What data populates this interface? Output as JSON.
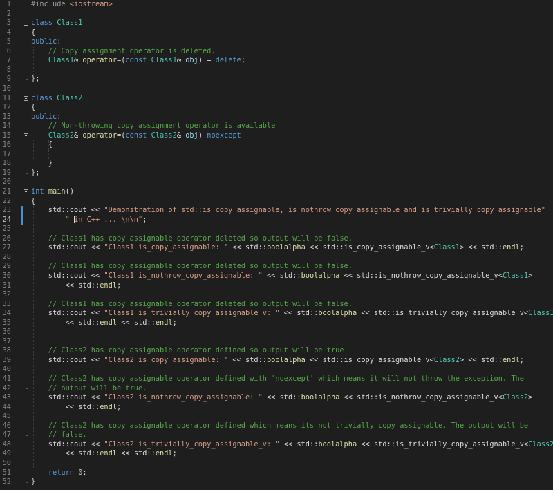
{
  "editor": {
    "current_line": 24,
    "lines": [
      [
        [
          "pp",
          "#include "
        ],
        [
          "st",
          "<iostream>"
        ]
      ],
      [],
      [
        [
          "kw",
          "class "
        ],
        [
          "ty",
          "Class1"
        ]
      ],
      [
        [
          "pl",
          "{"
        ]
      ],
      [
        [
          "kw",
          "public"
        ],
        [
          "pl",
          ":"
        ]
      ],
      [
        [
          "pl",
          "    "
        ],
        [
          "cm",
          "// Copy assignment operator is deleted."
        ]
      ],
      [
        [
          "pl",
          "    "
        ],
        [
          "ty",
          "Class1"
        ],
        [
          "pl",
          "& "
        ],
        [
          "fn",
          "operator="
        ],
        [
          "pl",
          "("
        ],
        [
          "kw",
          "const "
        ],
        [
          "ty",
          "Class1"
        ],
        [
          "pl",
          "& "
        ],
        [
          "pr",
          "obj"
        ],
        [
          "pl",
          ") = "
        ],
        [
          "kw",
          "delete"
        ],
        [
          "pl",
          ";"
        ]
      ],
      [],
      [
        [
          "pl",
          "};"
        ]
      ],
      [],
      [
        [
          "kw",
          "class "
        ],
        [
          "ty",
          "Class2"
        ]
      ],
      [
        [
          "pl",
          "{"
        ]
      ],
      [
        [
          "kw",
          "public"
        ],
        [
          "pl",
          ":"
        ]
      ],
      [
        [
          "pl",
          "    "
        ],
        [
          "cm",
          "// Non-throwing copy assignment operator is available"
        ]
      ],
      [
        [
          "pl",
          "    "
        ],
        [
          "ty",
          "Class2"
        ],
        [
          "pl",
          "& "
        ],
        [
          "fn",
          "operator="
        ],
        [
          "pl",
          "("
        ],
        [
          "kw",
          "const "
        ],
        [
          "ty",
          "Class2"
        ],
        [
          "pl",
          "& "
        ],
        [
          "pr",
          "obj"
        ],
        [
          "pl",
          ") "
        ],
        [
          "kw",
          "noexcept"
        ]
      ],
      [
        [
          "pl",
          "    {"
        ]
      ],
      [],
      [
        [
          "pl",
          "    }"
        ]
      ],
      [
        [
          "pl",
          "};"
        ]
      ],
      [],
      [
        [
          "kw",
          "int "
        ],
        [
          "fn",
          "main"
        ],
        [
          "pl",
          "()"
        ]
      ],
      [
        [
          "pl",
          "{"
        ]
      ],
      [
        [
          "pl",
          "    std::cout << "
        ],
        [
          "st",
          "\"Demonstration of std::is_copy_assignable, is_nothrow_copy_assignable and is_trivially_copy_assignable\""
        ]
      ],
      [
        [
          "pl",
          "        "
        ],
        [
          "st",
          "\" in C++ ... \\n\\n\""
        ],
        [
          "pl",
          ";"
        ]
      ],
      [],
      [
        [
          "pl",
          "    "
        ],
        [
          "cm",
          "// Class1 has copy assignable operator deleted so output will be false."
        ]
      ],
      [
        [
          "pl",
          "    std::cout << "
        ],
        [
          "st",
          "\"Class1 is_copy_assignable: \""
        ],
        [
          "pl",
          " << std::"
        ],
        [
          "fn",
          "boolalpha"
        ],
        [
          "pl",
          " << std::is_copy_assignable_v<"
        ],
        [
          "ty",
          "Class1"
        ],
        [
          "pl",
          "> << std::"
        ],
        [
          "fn",
          "endl"
        ],
        [
          "pl",
          ";"
        ]
      ],
      [],
      [
        [
          "pl",
          "    "
        ],
        [
          "cm",
          "// Class1 has copy assignable operator deleted so output will be false."
        ]
      ],
      [
        [
          "pl",
          "    std::cout << "
        ],
        [
          "st",
          "\"Class1 is_nothrow_copy_assignable: \""
        ],
        [
          "pl",
          " << std::"
        ],
        [
          "fn",
          "boolalpha"
        ],
        [
          "pl",
          " << std::is_nothrow_copy_assignable_v<"
        ],
        [
          "ty",
          "Class1"
        ],
        [
          "pl",
          ">"
        ]
      ],
      [
        [
          "pl",
          "        << std::"
        ],
        [
          "fn",
          "endl"
        ],
        [
          "pl",
          ";"
        ]
      ],
      [],
      [
        [
          "pl",
          "    "
        ],
        [
          "cm",
          "// Class1 has copy assignable operator deleted so output will be false."
        ]
      ],
      [
        [
          "pl",
          "    std::cout << "
        ],
        [
          "st",
          "\"Class1 is_trivially_copy_assignable_v: \""
        ],
        [
          "pl",
          " << std::"
        ],
        [
          "fn",
          "boolalpha"
        ],
        [
          "pl",
          " << std::is_trivially_copy_assignable_v<"
        ],
        [
          "ty",
          "Class1"
        ],
        [
          "pl",
          ">"
        ]
      ],
      [
        [
          "pl",
          "        << std::"
        ],
        [
          "fn",
          "endl"
        ],
        [
          "pl",
          " << std::"
        ],
        [
          "fn",
          "endl"
        ],
        [
          "pl",
          ";"
        ]
      ],
      [],
      [],
      [
        [
          "pl",
          "    "
        ],
        [
          "cm",
          "// Class2 has copy assignable operator defined so output will be true."
        ]
      ],
      [
        [
          "pl",
          "    std::cout << "
        ],
        [
          "st",
          "\"Class2 is_copy_assignable: \""
        ],
        [
          "pl",
          " << std::"
        ],
        [
          "fn",
          "boolalpha"
        ],
        [
          "pl",
          " << std::is_copy_assignable_v<"
        ],
        [
          "ty",
          "Class2"
        ],
        [
          "pl",
          "> << std::"
        ],
        [
          "fn",
          "endl"
        ],
        [
          "pl",
          ";"
        ]
      ],
      [],
      [
        [
          "pl",
          "    "
        ],
        [
          "cm",
          "// Class2 has copy assignable operator defined with 'noexcept' which means it will not throw the exception. The"
        ]
      ],
      [
        [
          "pl",
          "    "
        ],
        [
          "cm",
          "// output will be true."
        ]
      ],
      [
        [
          "pl",
          "    std::cout << "
        ],
        [
          "st",
          "\"Class2 is_nothrow_copy_assignable: \""
        ],
        [
          "pl",
          " << std::"
        ],
        [
          "fn",
          "boolalpha"
        ],
        [
          "pl",
          " << std::is_nothrow_copy_assignable_v<"
        ],
        [
          "ty",
          "Class2"
        ],
        [
          "pl",
          ">"
        ]
      ],
      [
        [
          "pl",
          "        << std::"
        ],
        [
          "fn",
          "endl"
        ],
        [
          "pl",
          ";"
        ]
      ],
      [],
      [
        [
          "pl",
          "    "
        ],
        [
          "cm",
          "// Class2 has copy assignable operator defined which means its not trivially copy assignable. The output will be"
        ]
      ],
      [
        [
          "pl",
          "    "
        ],
        [
          "cm",
          "// false."
        ]
      ],
      [
        [
          "pl",
          "    std::cout << "
        ],
        [
          "st",
          "\"Class2 is_trivially_copy_assignable_v: \""
        ],
        [
          "pl",
          " << std::"
        ],
        [
          "fn",
          "boolalpha"
        ],
        [
          "pl",
          " << std::is_trivially_copy_assignable_v<"
        ],
        [
          "ty",
          "Class2"
        ],
        [
          "pl",
          ">"
        ]
      ],
      [
        [
          "pl",
          "        << std::"
        ],
        [
          "fn",
          "endl"
        ],
        [
          "pl",
          " << std::"
        ],
        [
          "fn",
          "endl"
        ],
        [
          "pl",
          ";"
        ]
      ],
      [],
      [
        [
          "pl",
          "    "
        ],
        [
          "kw",
          "return "
        ],
        [
          "nm",
          "0"
        ],
        [
          "pl",
          ";"
        ]
      ],
      [
        [
          "pl",
          "}"
        ]
      ]
    ]
  }
}
